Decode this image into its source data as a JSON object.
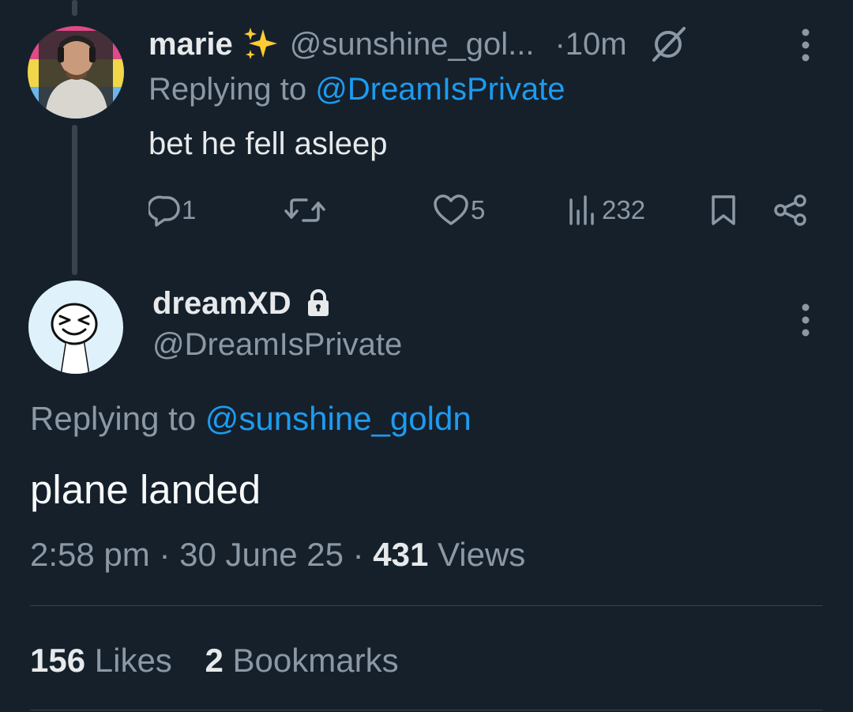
{
  "reply_tweet": {
    "display_name": "marie",
    "emoji": "✨",
    "handle": "@sunshine_gol...",
    "time": "·10m",
    "replying_prefix": "Replying to",
    "replying_handle": "@DreamIsPrivate",
    "text": "bet he fell asleep",
    "actions": {
      "replies": "1",
      "likes": "5",
      "views": "232"
    }
  },
  "main_tweet": {
    "display_name": "dreamXD",
    "handle": "@DreamIsPrivate",
    "replying_prefix": "Replying to",
    "replying_handle": "@sunshine_goldn",
    "text": "plane landed",
    "time": "2:58 pm",
    "date": "30 June 25",
    "views_count": "431",
    "views_label": "Views",
    "likes_count": "156",
    "likes_label": "Likes",
    "bookmarks_count": "2",
    "bookmarks_label": "Bookmarks"
  },
  "colors": {
    "background": "#15202b",
    "text": "#e7e9ea",
    "muted": "#8b98a5",
    "link": "#1d9bf0",
    "divider": "#38444d",
    "sparkle": "#ffcc33"
  },
  "icons": [
    "reply-icon",
    "retweet-icon",
    "like-icon",
    "views-icon",
    "bookmark-icon",
    "share-icon",
    "more-icon",
    "lock-icon",
    "grok-icon",
    "sparkles-emoji"
  ]
}
